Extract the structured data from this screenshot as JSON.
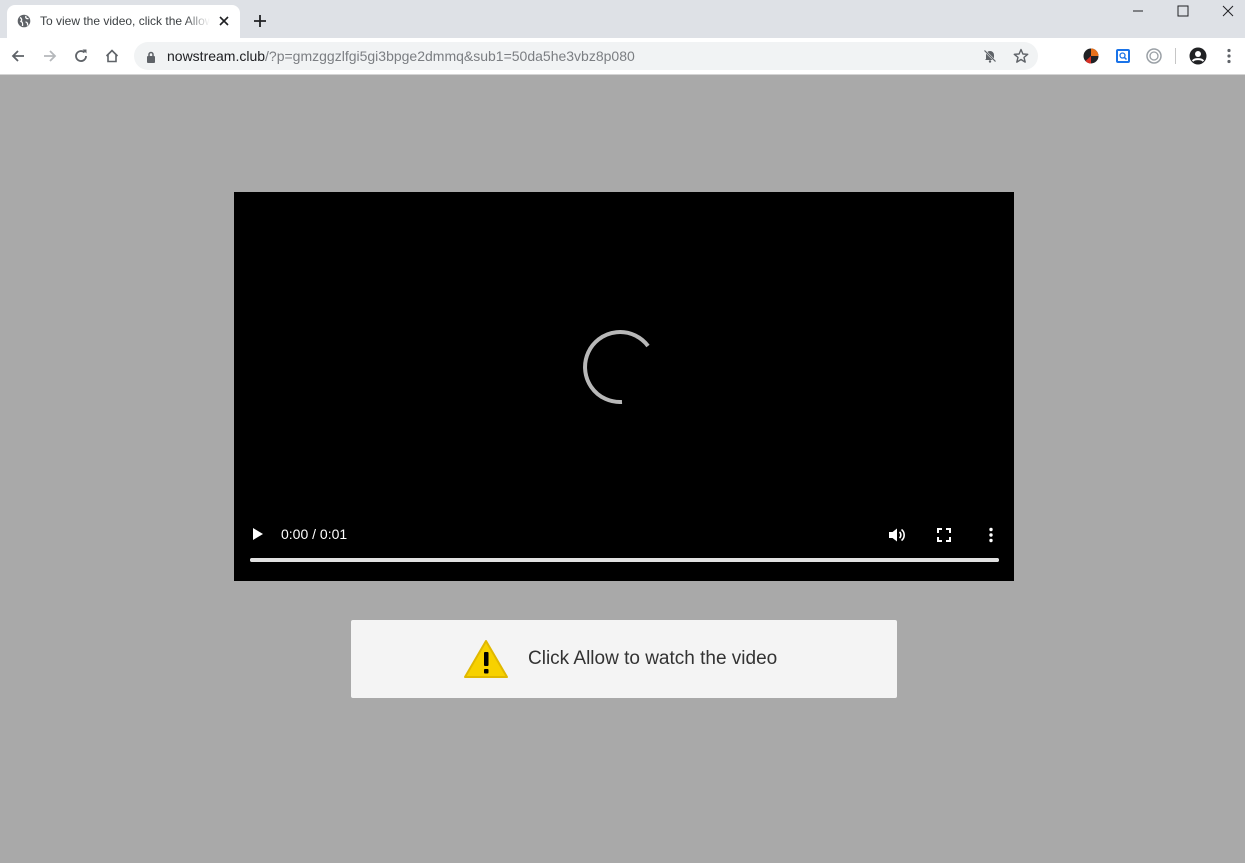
{
  "browser": {
    "tab_title": "To view the video, click the Allow button",
    "url_host": "nowstream.club",
    "url_path": "/?p=gmzggzlfgi5gi3bpge2dmmq&sub1=50da5he3vbz8p080"
  },
  "video": {
    "time": "0:00 / 0:01",
    "progress": 1.0
  },
  "notice": {
    "text": "Click Allow to watch the video"
  },
  "colors": {
    "page_bg": "#a9a9a9",
    "video_bg": "#000000",
    "notice_bg": "#f4f4f4",
    "warning_yellow": "#f7d100"
  },
  "icons": {
    "tab_favicon": "globe-icon",
    "tab_close": "close-icon",
    "new_tab": "plus-icon",
    "back": "back-arrow-icon",
    "forward": "forward-arrow-icon",
    "reload": "reload-icon",
    "home": "home-icon",
    "lock": "lock-icon",
    "notifications_blocked": "notifications-blocked-icon",
    "bookmark": "star-icon",
    "profile": "account-icon",
    "menu": "kebab-menu-icon",
    "video_play": "play-icon",
    "video_volume": "volume-icon",
    "video_fullscreen": "fullscreen-icon",
    "video_more": "more-vertical-icon",
    "notice": "warning-icon"
  }
}
